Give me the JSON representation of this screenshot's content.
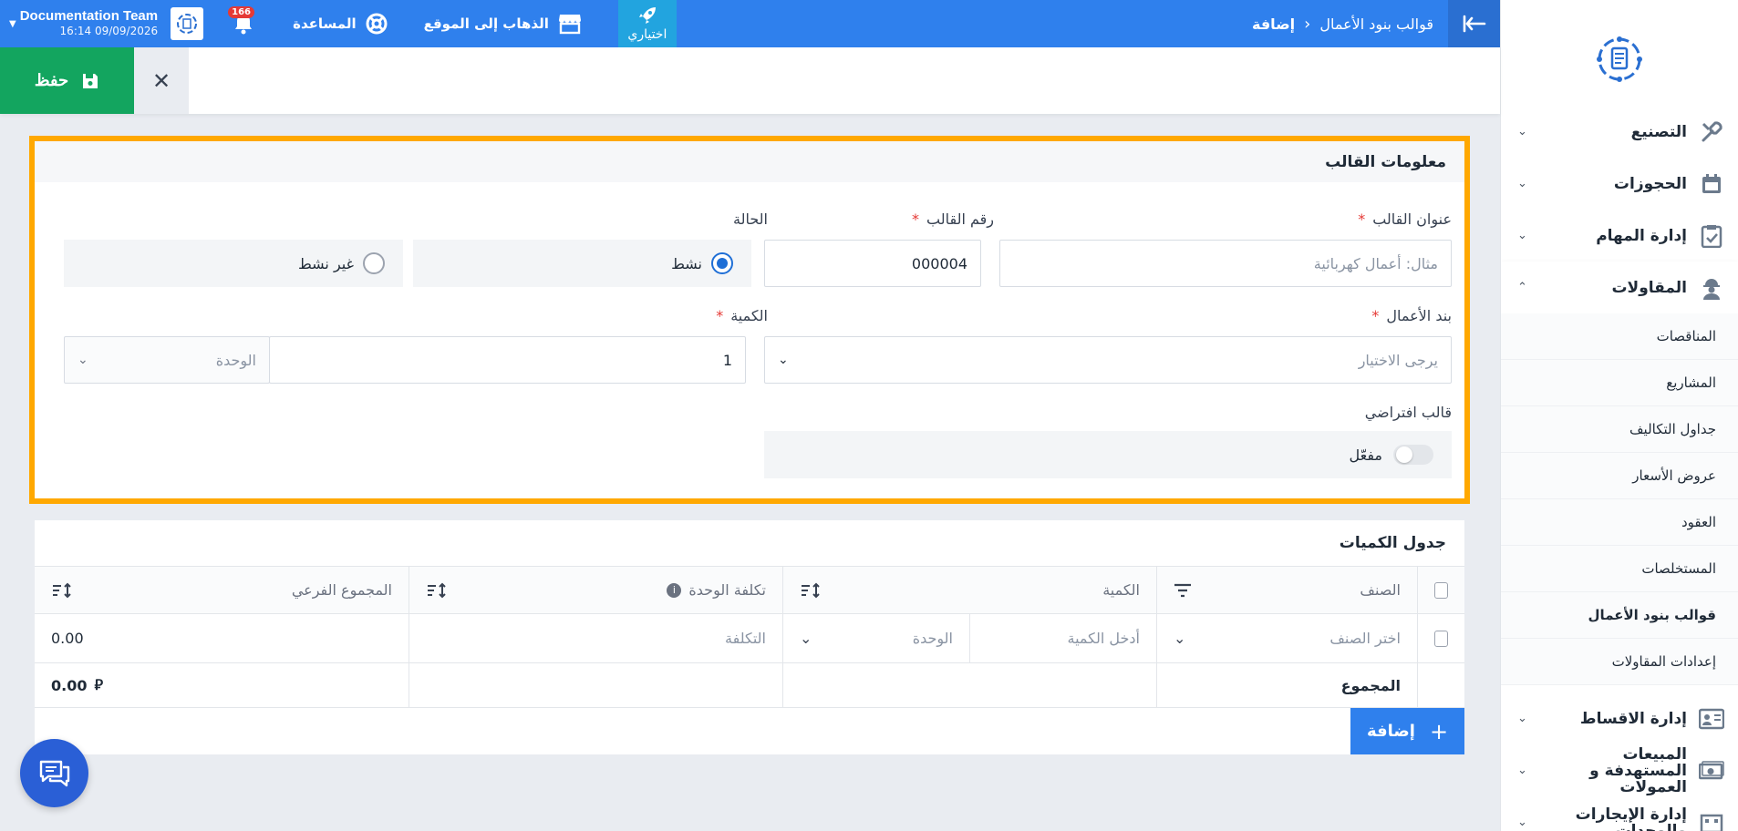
{
  "sidebar": {
    "items": [
      {
        "label": "التصنيع",
        "icon": "tools-icon"
      },
      {
        "label": "الحجوزات",
        "icon": "calendar-icon"
      },
      {
        "label": "إدارة المهام",
        "icon": "clipboard-check-icon"
      },
      {
        "label": "المقاولات",
        "icon": "worker-icon"
      }
    ],
    "sub_items": [
      "المناقصات",
      "المشاريع",
      "جداول التكاليف",
      "عروض الأسعار",
      "العقود",
      "المستخلصات",
      "قوالب بنود الأعمال",
      "إعدادات المقاولات"
    ],
    "bottom_items": [
      {
        "label": "إدارة الاقساط",
        "icon": "installments-icon"
      },
      {
        "label": "المبيعات المستهدفة و العمولات",
        "icon": "money-icon"
      },
      {
        "label": "إدارة الإيجارات والوحدات",
        "icon": "building-icon"
      }
    ]
  },
  "topbar": {
    "breadcrumb_parent": "قوالب بنود الأعمال",
    "breadcrumb_current": "إضافة",
    "shortcut_label": "اختياري",
    "visit_site": "الذهاب إلى الموقع",
    "help": "المساعدة",
    "notifications_count": "166",
    "user_name": "Documentation Team",
    "user_datetime": "16:14 09/09/2026"
  },
  "actions": {
    "save": "حفظ"
  },
  "template_info": {
    "section_title": "معلومات القالب",
    "title_label": "عنوان القالب",
    "title_placeholder": "مثال: أعمال كهربائية",
    "number_label": "رقم القالب",
    "number_value": "000004",
    "status_label": "الحالة",
    "status_active": "نشط",
    "status_inactive": "غير نشط",
    "work_item_label": "بند الأعمال",
    "work_item_placeholder": "يرجى الاختيار",
    "quantity_label": "الكمية",
    "quantity_value": "1",
    "unit_placeholder": "الوحدة",
    "default_label": "قالب افتراضي",
    "default_toggle_label": "مفعّل"
  },
  "quantities": {
    "section_title": "جدول الكميات",
    "headers": {
      "item": "الصنف",
      "quantity": "الكمية",
      "unit_cost": "تكلفة الوحدة",
      "subtotal": "المجموع الفرعي"
    },
    "row": {
      "item_placeholder": "اختر الصنف",
      "qty_placeholder": "أدخل الكمية",
      "unit_placeholder": "الوحدة",
      "cost_placeholder": "التكلفة",
      "subtotal": "0.00"
    },
    "total_label": "المجموع",
    "total_value": "0.00",
    "currency_symbol": "⃁",
    "add_label": "إضافة"
  },
  "colors": {
    "primary": "#2f80ed",
    "save": "#13a55f",
    "highlight": "#ffa800",
    "required": "#e53935"
  }
}
